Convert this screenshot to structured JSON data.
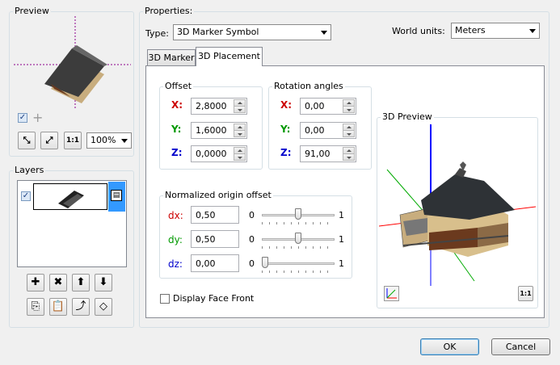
{
  "preview": {
    "title": "Preview",
    "zoom": "100%",
    "checkbox_checked": true,
    "buttons": [
      "collapse-icon",
      "expand-icon",
      "actual-size-icon"
    ],
    "actual_size_label": "1:1"
  },
  "layers": {
    "title": "Layers",
    "items": [
      {
        "checked": true,
        "selected": true
      }
    ],
    "buttons": [
      "add-icon",
      "delete-icon",
      "move-up-icon",
      "move-down-icon",
      "copy-icon",
      "paste-icon",
      "export-icon",
      "tag-icon"
    ]
  },
  "properties": {
    "title": "Properties:",
    "type_label": "Type:",
    "type_value": "3D Marker Symbol",
    "world_units_label": "World units:",
    "world_units_value": "Meters"
  },
  "tabs": [
    "3D Marker",
    "3D Placement"
  ],
  "offset": {
    "title": "Offset",
    "rows": [
      {
        "label": "X:",
        "value": "2,8000",
        "color": "#cc0000"
      },
      {
        "label": "Y:",
        "value": "1,6000",
        "color": "#009900"
      },
      {
        "label": "Z:",
        "value": "0,0000",
        "color": "#0000cc"
      }
    ]
  },
  "rotation": {
    "title": "Rotation angles",
    "rows": [
      {
        "label": "X:",
        "value": "0,00",
        "color": "#cc0000"
      },
      {
        "label": "Y:",
        "value": "0,00",
        "color": "#009900"
      },
      {
        "label": "Z:",
        "value": "91,00",
        "color": "#0000cc"
      }
    ]
  },
  "normalized": {
    "title": "Normalized origin offset",
    "rows": [
      {
        "label": "dx:",
        "value": "0,50",
        "min": "0",
        "max": "1",
        "position": 0.5,
        "color": "#cc0000"
      },
      {
        "label": "dy:",
        "value": "0,50",
        "min": "0",
        "max": "1",
        "position": 0.5,
        "color": "#009900"
      },
      {
        "label": "dz:",
        "value": "0,00",
        "min": "0",
        "max": "1",
        "position": 0.0,
        "color": "#0000cc"
      }
    ]
  },
  "display_face_front": {
    "label": "Display Face Front",
    "checked": false
  },
  "preview3d": {
    "title": "3D Preview",
    "actual_size_label": "1:1"
  },
  "ok_label": "OK",
  "cancel_label": "Cancel"
}
